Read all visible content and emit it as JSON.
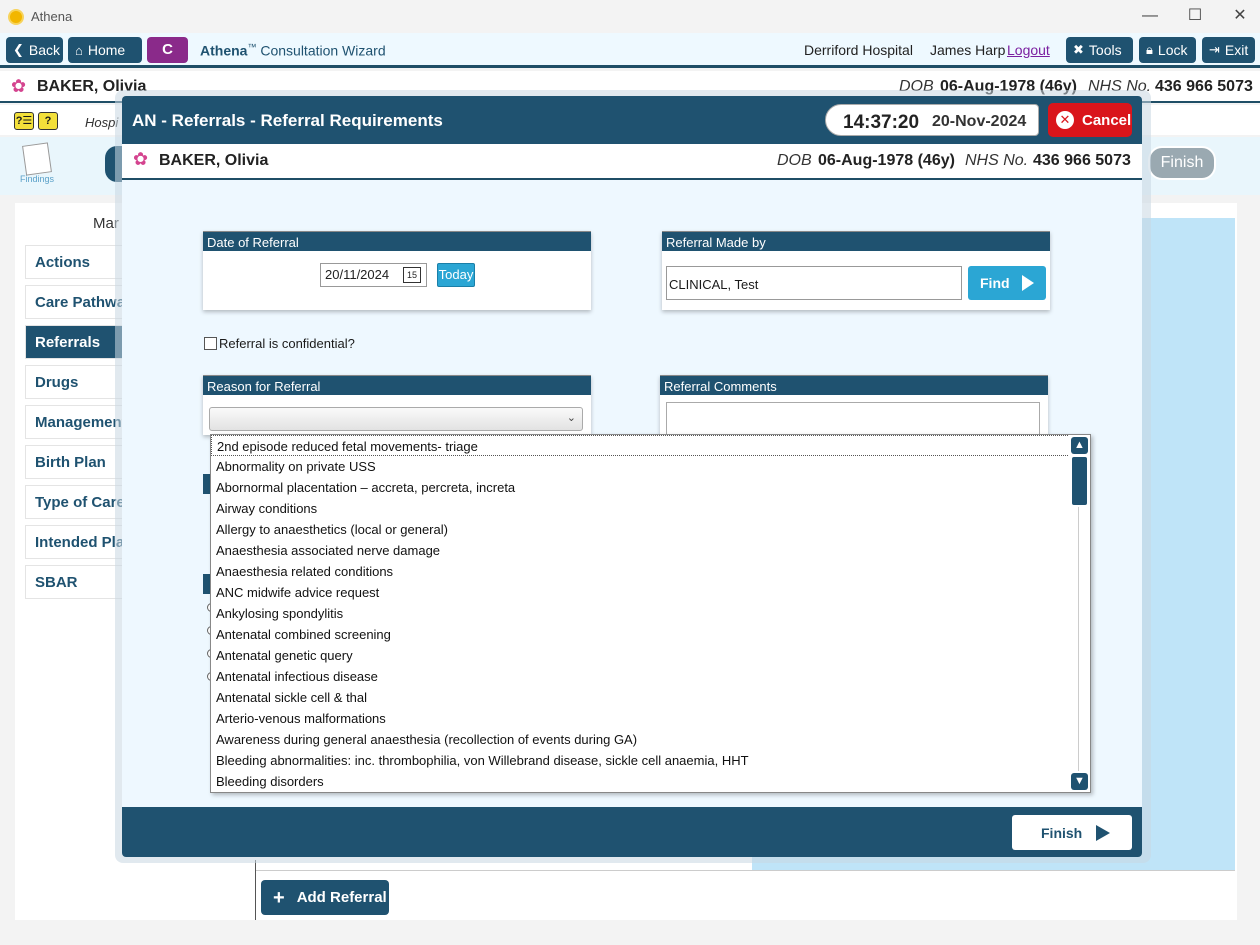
{
  "window": {
    "title": "Athena"
  },
  "toolbar": {
    "back_label": "Back",
    "home_label": "Home",
    "badge": "C",
    "wizard_brand": "Athena",
    "wizard_tm": "™",
    "wizard_title": "Consultation Wizard",
    "hospital": "Derriford Hospital",
    "user": "James Harp",
    "logout": "Logout",
    "tools_label": "Tools",
    "lock_label": "Lock",
    "exit_label": "Exit"
  },
  "patient": {
    "name": "BAKER, Olivia",
    "dob_label": "DOB",
    "dob": "06-Aug-1978 (46y)",
    "nhs_label": "NHS No.",
    "nhs": "436 966 5073"
  },
  "row2": {
    "hosp_text": "Hospi"
  },
  "nav": {
    "findings_label": "Findings",
    "finish_label": "Finish"
  },
  "sidebar": {
    "header": "Mar",
    "items": [
      {
        "label": "Actions",
        "active": false
      },
      {
        "label": "Care Pathway",
        "active": false
      },
      {
        "label": "Referrals",
        "active": true
      },
      {
        "label": "Drugs",
        "active": false
      },
      {
        "label": "Management",
        "active": false
      },
      {
        "label": "Birth Plan",
        "active": false
      },
      {
        "label": "Type of Care",
        "active": false
      },
      {
        "label": "Intended Pla",
        "active": false
      },
      {
        "label": "SBAR",
        "active": false
      }
    ]
  },
  "add_referral_label": "Add Referral",
  "modal": {
    "title": "AN - Referrals - Referral Requirements",
    "time": "14:37:20",
    "date": "20-Nov-2024",
    "cancel_label": "Cancel",
    "date_section": {
      "header": "Date of Referral",
      "value": "20/11/2024",
      "calendar_day": "15",
      "today_label": "Today"
    },
    "made_by_section": {
      "header": "Referral Made by",
      "value": "CLINICAL, Test",
      "find_label": "Find"
    },
    "confidential_label": "Referral is confidential?",
    "reason_section": {
      "header": "Reason for Referral",
      "selected": ""
    },
    "comments_section": {
      "header": "Referral Comments",
      "value": ""
    },
    "finish_label": "Finish"
  },
  "dropdown": {
    "options": [
      "2nd episode reduced fetal movements- triage",
      "Abnormality on private USS",
      "Abornormal placentation – accreta, percreta, increta",
      "Airway conditions",
      "Allergy to anaesthetics (local or general)",
      "Anaesthesia associated nerve damage",
      "Anaesthesia related conditions",
      "ANC midwife advice request",
      "Ankylosing spondylitis",
      "Antenatal combined screening",
      "Antenatal genetic query",
      "Antenatal infectious disease",
      "Antenatal sickle cell & thal",
      "Arterio-venous malformations",
      "Awareness during general anaesthesia (recollection of events during GA)",
      "Bleeding abnormalities: inc. thrombophilia, von Willebrand disease, sickle cell anaemia, HHT",
      "Bleeding disorders"
    ],
    "highlighted_index": 0
  },
  "colors": {
    "primary": "#1f5270",
    "accent": "#2ba6d4",
    "cancel": "#d9151b",
    "badge": "#8a2a8a"
  }
}
